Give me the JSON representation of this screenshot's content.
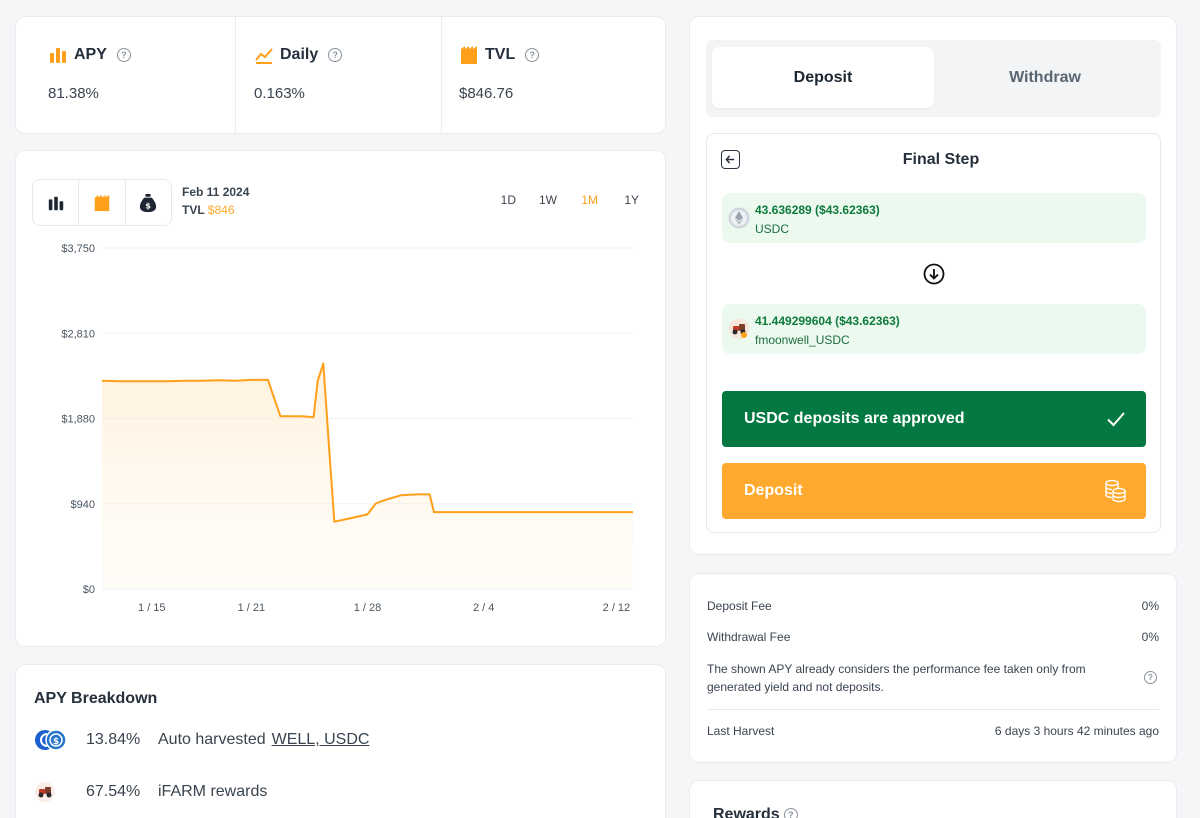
{
  "stats": [
    {
      "label": "APY",
      "value": "81.38%",
      "icon": "bar-chart-icon"
    },
    {
      "label": "Daily",
      "value": "0.163%",
      "icon": "trend-line-icon"
    },
    {
      "label": "TVL",
      "value": "$846.76",
      "icon": "tvl-icon"
    }
  ],
  "chart_header": {
    "date": "Feb 11 2024",
    "tvl_label": "TVL",
    "tvl_value": "$846",
    "ranges": [
      "1D",
      "1W",
      "1M",
      "1Y"
    ],
    "active_range": "1M"
  },
  "colors": {
    "accent": "#ff9f1a",
    "approved": "#037941",
    "deposit": "#ffa92e",
    "token_bg": "#ecf9ef"
  },
  "chart_data": {
    "type": "area",
    "series": [
      {
        "values": [
          {
            "x": "2024-01-12",
            "y": 2290
          },
          {
            "x": "2024-01-13",
            "y": 2285
          },
          {
            "x": "2024-01-14",
            "y": 2285
          },
          {
            "x": "2024-01-15",
            "y": 2285
          },
          {
            "x": "2024-01-16",
            "y": 2285
          },
          {
            "x": "2024-01-17",
            "y": 2290
          },
          {
            "x": "2024-01-18",
            "y": 2290
          },
          {
            "x": "2024-01-19",
            "y": 2295
          },
          {
            "x": "2024-01-20",
            "y": 2290
          },
          {
            "x": "2024-01-21",
            "y": 2300
          },
          {
            "x": "2024-01-22",
            "y": 2300
          },
          {
            "x": "2024-01-22T18",
            "y": 1900
          },
          {
            "x": "2024-01-24",
            "y": 1900
          },
          {
            "x": "2024-01-24T18",
            "y": 1890
          },
          {
            "x": "2024-01-25",
            "y": 2290
          },
          {
            "x": "2024-01-25T08",
            "y": 2480
          },
          {
            "x": "2024-01-25T16",
            "y": 1600
          },
          {
            "x": "2024-01-26",
            "y": 740
          },
          {
            "x": "2024-01-27",
            "y": 780
          },
          {
            "x": "2024-01-28",
            "y": 820
          },
          {
            "x": "2024-01-28T12",
            "y": 940
          },
          {
            "x": "2024-01-29",
            "y": 975
          },
          {
            "x": "2024-01-30",
            "y": 1030
          },
          {
            "x": "2024-01-31",
            "y": 1040
          },
          {
            "x": "2024-01-31T18",
            "y": 1040
          },
          {
            "x": "2024-02-01",
            "y": 846
          },
          {
            "x": "2024-02-03",
            "y": 846
          },
          {
            "x": "2024-02-05",
            "y": 846
          },
          {
            "x": "2024-02-08",
            "y": 846
          },
          {
            "x": "2024-02-11",
            "y": 846
          },
          {
            "x": "2024-02-13",
            "y": 846
          }
        ]
      }
    ],
    "x_ticks": [
      "1 / 15",
      "1 / 21",
      "1 / 28",
      "2 / 4",
      "2 / 12"
    ],
    "y_ticks": [
      "$0",
      "$940",
      "$1,880",
      "$2,810",
      "$3,750"
    ],
    "ylim": [
      0,
      3750
    ],
    "grid": true
  },
  "breakdown": {
    "title": "APY Breakdown",
    "rows": [
      {
        "pct": "13.84%",
        "desc": "Auto harvested",
        "link": "WELL, USDC"
      },
      {
        "pct": "67.54%",
        "desc": "iFARM rewards",
        "link": ""
      }
    ]
  },
  "panel": {
    "tabs": [
      "Deposit",
      "Withdraw"
    ],
    "active_tab": "Deposit",
    "step_title": "Final Step",
    "from_amount": "43.636289 ($43.62363)",
    "from_token": "USDC",
    "to_amount": "41.449299604 ($43.62363)",
    "to_token": "fmoonwell_USDC",
    "approved_label": "USDC deposits are approved",
    "deposit_label": "Deposit"
  },
  "fees": {
    "deposit_fee_label": "Deposit Fee",
    "deposit_fee": "0%",
    "withdrawal_fee_label": "Withdrawal Fee",
    "withdrawal_fee": "0%",
    "note": "The shown APY already considers the performance fee taken only from generated yield and not deposits.",
    "last_harvest_label": "Last Harvest",
    "last_harvest": "6 days 3 hours 42 minutes ago"
  },
  "rewards": {
    "title": "Rewards"
  }
}
